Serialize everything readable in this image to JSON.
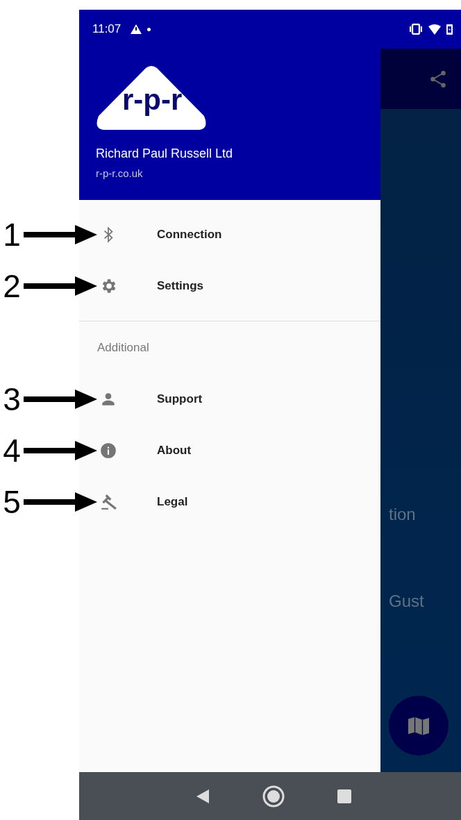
{
  "status_bar": {
    "time": "11:07"
  },
  "drawer": {
    "header": {
      "logo_text": "r-p-r",
      "company": "Richard Paul Russell Ltd",
      "website": "r-p-r.co.uk"
    },
    "sections": [
      {
        "items": [
          {
            "label": "Connection",
            "kind": "bluetooth",
            "callout": "1"
          },
          {
            "label": "Settings",
            "kind": "gear",
            "callout": "2"
          }
        ]
      },
      {
        "subheader": "Additional",
        "items": [
          {
            "label": "Support",
            "kind": "person",
            "callout": "3"
          },
          {
            "label": "About",
            "kind": "info",
            "callout": "4"
          },
          {
            "label": "Legal",
            "kind": "gavel",
            "callout": "5"
          }
        ]
      }
    ]
  },
  "background": {
    "texts": [
      "tion",
      "Gust"
    ]
  }
}
